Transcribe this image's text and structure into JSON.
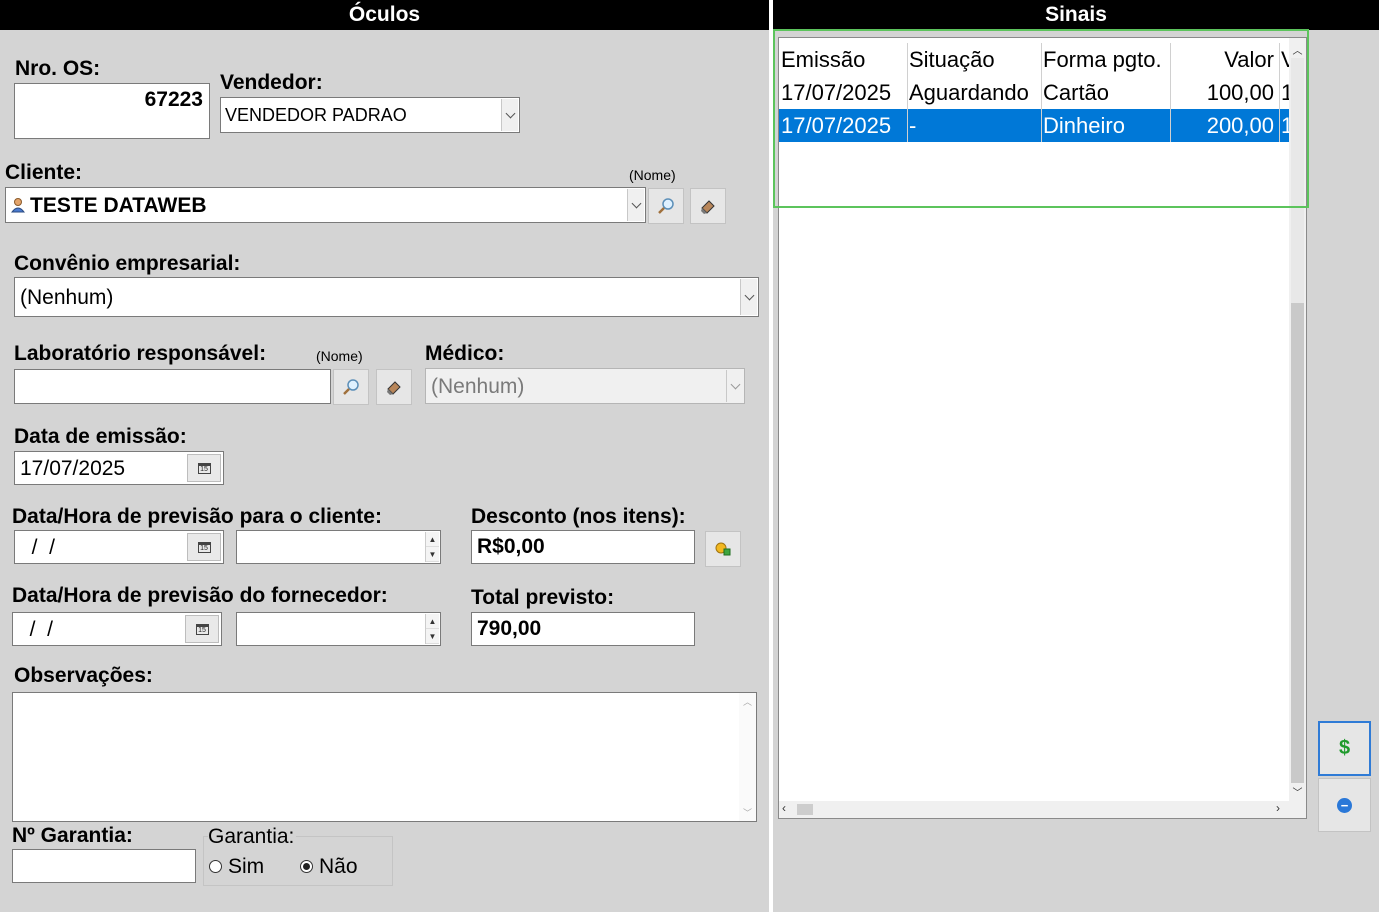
{
  "left_panel": {
    "title": "Óculos",
    "nro_os": {
      "label": "Nro. OS:",
      "value": "67223"
    },
    "vendedor": {
      "label": "Vendedor:",
      "value": "VENDEDOR PADRAO"
    },
    "cliente": {
      "label": "Cliente:",
      "hint": "(Nome)",
      "value": "TESTE DATAWEB"
    },
    "convenio": {
      "label": "Convênio empresarial:",
      "value": "(Nenhum)"
    },
    "laboratorio": {
      "label": "Laboratório responsável:",
      "hint": "(Nome)",
      "value": ""
    },
    "medico": {
      "label": "Médico:",
      "value": "(Nenhum)"
    },
    "data_emissao": {
      "label": "Data de emissão:",
      "value": "17/07/2025"
    },
    "previsao_cliente": {
      "label": "Data/Hora de previsão para o cliente:",
      "date": "  /  /",
      "time": ""
    },
    "desconto": {
      "label": "Desconto (nos itens):",
      "value": "R$0,00"
    },
    "previsao_fornecedor": {
      "label": "Data/Hora de previsão do fornecedor:",
      "date": "  /  /",
      "time": ""
    },
    "total_previsto": {
      "label": "Total previsto:",
      "value": "790,00"
    },
    "observacoes": {
      "label": "Observações:",
      "value": ""
    },
    "garantia_num": {
      "label": "Nº Garantia:",
      "value": ""
    },
    "garantia": {
      "label": "Garantia:",
      "options": [
        "Sim",
        "Não"
      ],
      "selected": "Não"
    }
  },
  "right_panel": {
    "title": "Sinais",
    "columns": [
      "Emissão",
      "Situação",
      "Forma pgto.",
      "Valor",
      "V"
    ],
    "rows": [
      {
        "emissao": "17/07/2025",
        "situacao": "Aguardando",
        "forma": "Cartão",
        "valor": "100,00",
        "extra": "1",
        "selected": false
      },
      {
        "emissao": "17/07/2025",
        "situacao": "-",
        "forma": "Dinheiro",
        "valor": "200,00",
        "extra": "1",
        "selected": true
      }
    ],
    "add_button_symbol": "$",
    "remove_button_symbol": "−"
  },
  "colors": {
    "panel": "#d4d4d4",
    "header": "#000000",
    "selection": "#0078d7",
    "highlight": "#5cc45c"
  }
}
